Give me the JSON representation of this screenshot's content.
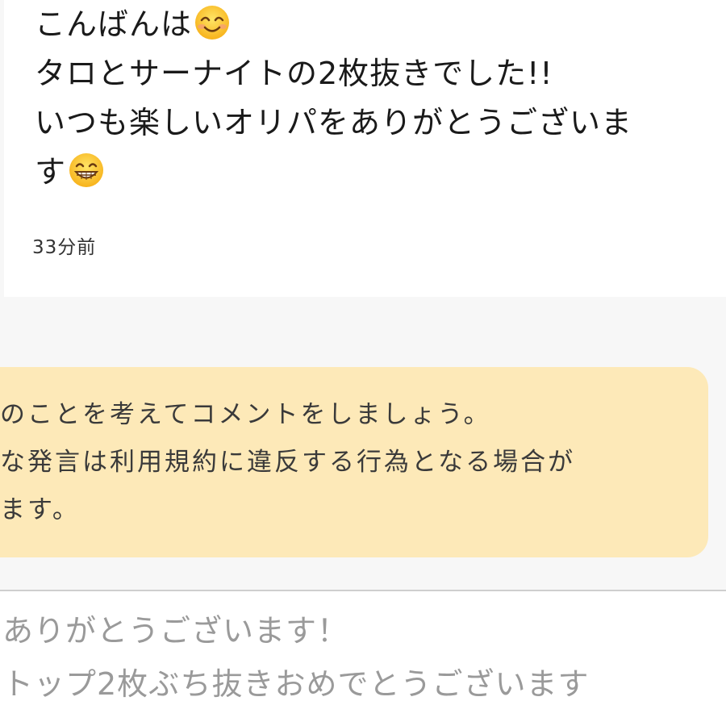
{
  "comment": {
    "lines": [
      "こんばんは",
      "タロとサーナイトの2枚抜きでした!!",
      "いつも楽しいオリパをありがとうございま",
      "す"
    ],
    "emoji_1": "smiling-face-icon",
    "emoji_2": "grinning-face-icon",
    "timestamp": "33分前"
  },
  "notice": {
    "lines": [
      "のことを考えてコメントをしましょう。",
      "な発言は利用規約に違反する行為となる場合が",
      "ます。"
    ],
    "background": "#fde9b8"
  },
  "input": {
    "lines": [
      "ありがとうございます！",
      "トップ2枚ぶち抜きおめでとうございます"
    ]
  },
  "colors": {
    "page_bg": "#f7f7f7",
    "card_bg": "#ffffff",
    "text": "#1a1a1a",
    "input_text": "#9a9a9a"
  }
}
